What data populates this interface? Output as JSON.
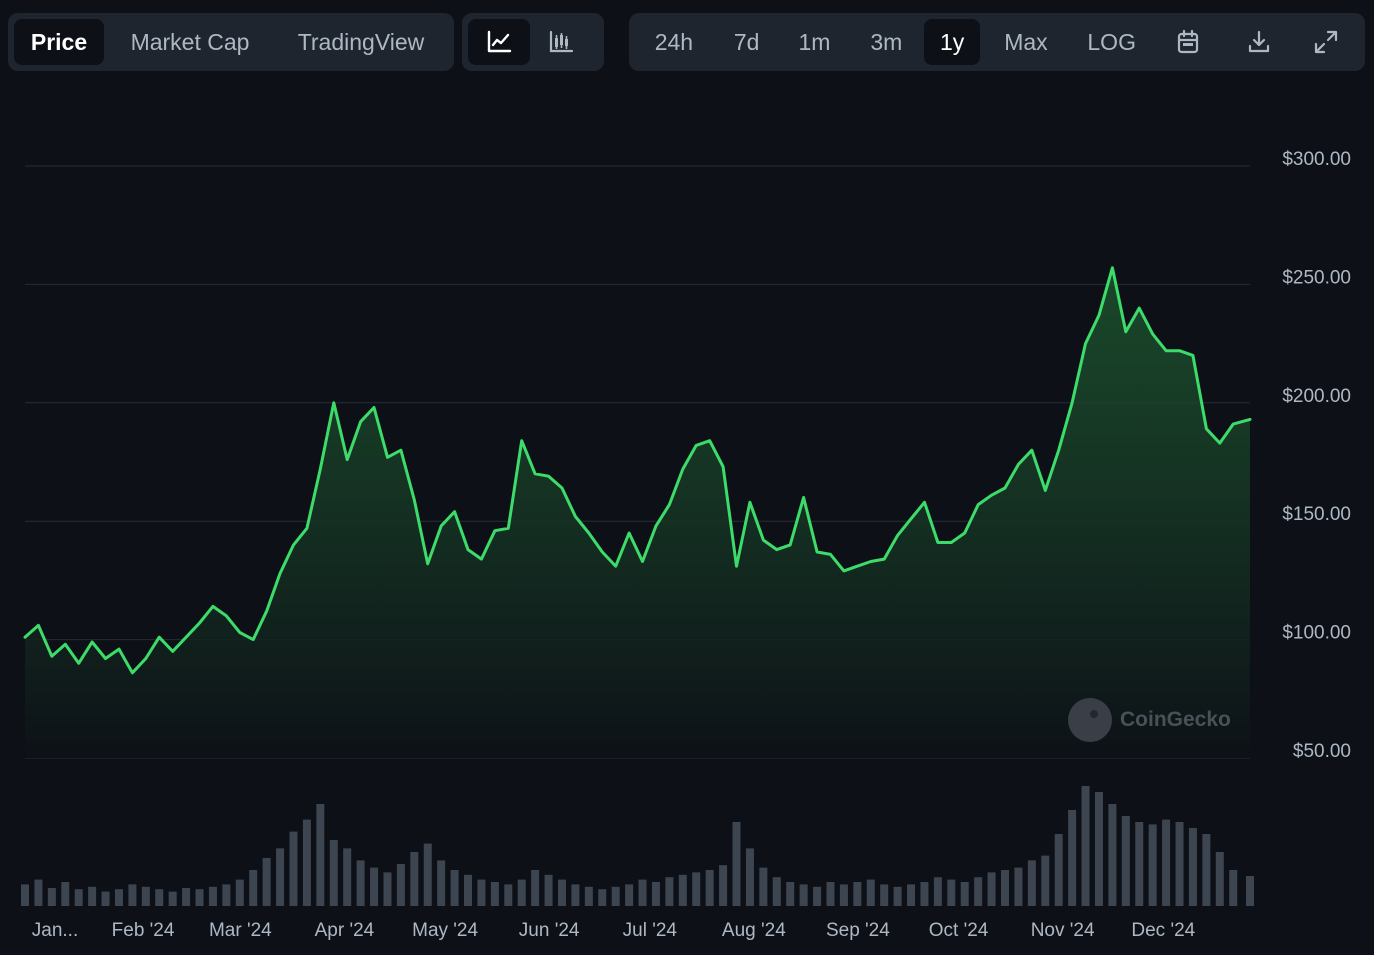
{
  "tabs": [
    {
      "label": "Price",
      "active": true
    },
    {
      "label": "Market Cap",
      "active": false
    },
    {
      "label": "TradingView",
      "active": false
    }
  ],
  "chart_type_buttons": [
    {
      "icon": "line-chart-icon",
      "active": true
    },
    {
      "icon": "candlestick-chart-icon",
      "active": false
    }
  ],
  "ranges": [
    {
      "label": "24h",
      "active": false
    },
    {
      "label": "7d",
      "active": false
    },
    {
      "label": "1m",
      "active": false
    },
    {
      "label": "3m",
      "active": false
    },
    {
      "label": "1y",
      "active": true
    },
    {
      "label": "Max",
      "active": false
    },
    {
      "label": "LOG",
      "active": false
    }
  ],
  "tool_icons": [
    "calendar-icon",
    "download-icon",
    "fullscreen-icon"
  ],
  "watermark": {
    "text": "CoinGecko",
    "icon": "coingecko-logo-icon"
  },
  "colors": {
    "background": "#0d1117",
    "line": "#3ddc6a",
    "area_top": "#1e5a31",
    "volume": "#4a5260",
    "panel": "#1f252e"
  },
  "chart_data": {
    "type": "line",
    "ylim": [
      50,
      300
    ],
    "yticks": [
      300,
      250,
      200,
      150,
      100,
      50
    ],
    "ytick_labels": [
      "$300.00",
      "$250.00",
      "$200.00",
      "$150.00",
      "$100.00",
      "$50.00"
    ],
    "xtick_labels": [
      "Jan...",
      "Feb '24",
      "Mar '24",
      "Apr '24",
      "May '24",
      "Jun '24",
      "Jul '24",
      "Aug '24",
      "Sep '24",
      "Oct '24",
      "Nov '24",
      "Dec '24"
    ],
    "x_start": "2024-01-01",
    "x_end": "2024-12-31",
    "grid": true,
    "series": [
      {
        "x": [
          "2024-01-01",
          "2024-01-05",
          "2024-01-09",
          "2024-01-13",
          "2024-01-17",
          "2024-01-21",
          "2024-01-25",
          "2024-01-29",
          "2024-02-02",
          "2024-02-06",
          "2024-02-10",
          "2024-02-14",
          "2024-02-18",
          "2024-02-22",
          "2024-02-26",
          "2024-03-01",
          "2024-03-05",
          "2024-03-09",
          "2024-03-13",
          "2024-03-17",
          "2024-03-21",
          "2024-03-25",
          "2024-03-29",
          "2024-04-02",
          "2024-04-06",
          "2024-04-10",
          "2024-04-14",
          "2024-04-18",
          "2024-04-22",
          "2024-04-26",
          "2024-04-30",
          "2024-05-04",
          "2024-05-08",
          "2024-05-12",
          "2024-05-16",
          "2024-05-20",
          "2024-05-24",
          "2024-05-28",
          "2024-06-01",
          "2024-06-05",
          "2024-06-09",
          "2024-06-13",
          "2024-06-17",
          "2024-06-21",
          "2024-06-25",
          "2024-06-29",
          "2024-07-03",
          "2024-07-07",
          "2024-07-11",
          "2024-07-15",
          "2024-07-19",
          "2024-07-23",
          "2024-07-27",
          "2024-07-31",
          "2024-08-04",
          "2024-08-08",
          "2024-08-12",
          "2024-08-16",
          "2024-08-20",
          "2024-08-24",
          "2024-08-28",
          "2024-09-01",
          "2024-09-05",
          "2024-09-09",
          "2024-09-13",
          "2024-09-17",
          "2024-09-21",
          "2024-09-25",
          "2024-09-29",
          "2024-10-03",
          "2024-10-07",
          "2024-10-11",
          "2024-10-15",
          "2024-10-19",
          "2024-10-23",
          "2024-10-27",
          "2024-10-31",
          "2024-11-04",
          "2024-11-08",
          "2024-11-12",
          "2024-11-16",
          "2024-11-20",
          "2024-11-24",
          "2024-11-28",
          "2024-12-02",
          "2024-12-06",
          "2024-12-10",
          "2024-12-14",
          "2024-12-18",
          "2024-12-22",
          "2024-12-26",
          "2024-12-31"
        ],
        "values": [
          101,
          106,
          93,
          98,
          90,
          99,
          92,
          96,
          86,
          92,
          101,
          95,
          101,
          107,
          114,
          110,
          103,
          100,
          112,
          128,
          140,
          147,
          172,
          200,
          176,
          192,
          198,
          177,
          180,
          159,
          132,
          148,
          154,
          138,
          134,
          146,
          147,
          184,
          170,
          169,
          164,
          152,
          145,
          137,
          131,
          145,
          133,
          148,
          157,
          172,
          182,
          184,
          173,
          131,
          158,
          142,
          138,
          140,
          160,
          137,
          136,
          129,
          131,
          133,
          134,
          144,
          151,
          158,
          141,
          141,
          145,
          157,
          161,
          164,
          174,
          180,
          163,
          180,
          200,
          225,
          237,
          257,
          230,
          240,
          229,
          222,
          222,
          220,
          189,
          183,
          191,
          193
        ],
        "volume": [
          18,
          22,
          15,
          20,
          14,
          16,
          12,
          14,
          18,
          16,
          14,
          12,
          15,
          14,
          16,
          18,
          22,
          30,
          40,
          48,
          62,
          72,
          85,
          55,
          48,
          38,
          32,
          28,
          35,
          45,
          52,
          38,
          30,
          26,
          22,
          20,
          18,
          22,
          30,
          26,
          22,
          18,
          16,
          14,
          16,
          18,
          22,
          20,
          24,
          26,
          28,
          30,
          34,
          70,
          48,
          32,
          24,
          20,
          18,
          16,
          20,
          18,
          20,
          22,
          18,
          16,
          18,
          20,
          24,
          22,
          20,
          24,
          28,
          30,
          32,
          38,
          42,
          60,
          80,
          100,
          95,
          85,
          75,
          70,
          68,
          72,
          70,
          65,
          60,
          45,
          30,
          25
        ]
      }
    ]
  }
}
